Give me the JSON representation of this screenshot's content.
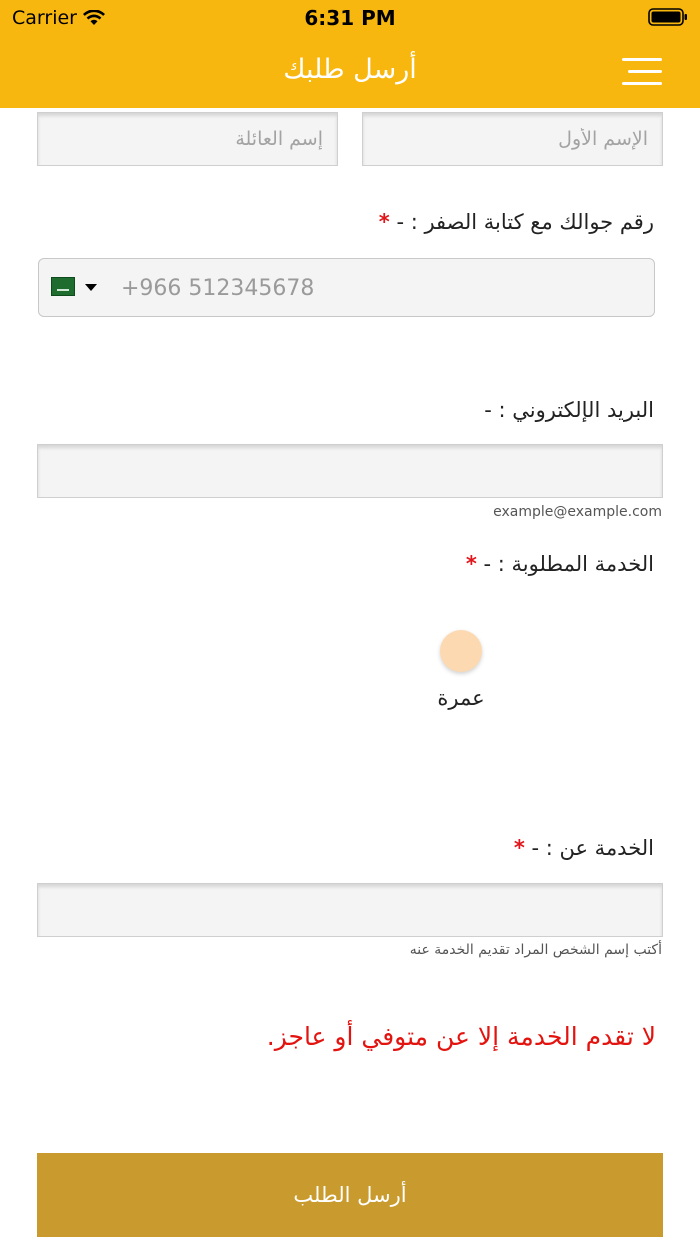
{
  "status_bar": {
    "carrier": "Carrier",
    "time": "6:31 PM"
  },
  "header": {
    "title": "أرسل طلبك",
    "menu_icon": "hamburger-menu-icon"
  },
  "name": {
    "first_placeholder": "الإسم الأول",
    "last_placeholder": "إسم العائلة"
  },
  "phone": {
    "label": "رقم جوالك مع كتابة الصفر : -",
    "required_mark": "*",
    "country_flag": "saudi-arabia-flag-icon",
    "placeholder": "+966 512345678"
  },
  "email": {
    "label": "البريد الإلكتروني : -",
    "hint": "example@example.com"
  },
  "service": {
    "label": "الخدمة المطلوبة : -",
    "required_mark": "*",
    "option": "عمرة",
    "radio_color": "#fcd9b1"
  },
  "service_for": {
    "label": "الخدمة عن : -",
    "required_mark": "*",
    "hint": "أكتب إسم الشخص المراد تقديم الخدمة عنه"
  },
  "warning": {
    "text": "لا تقدم الخدمة إلا عن متوفي أو عاجز.",
    "color": "#e3140f"
  },
  "submit": {
    "label": "أرسل الطلب",
    "color": "#C99A2E"
  },
  "theme": {
    "header_color": "#F7B70F"
  }
}
